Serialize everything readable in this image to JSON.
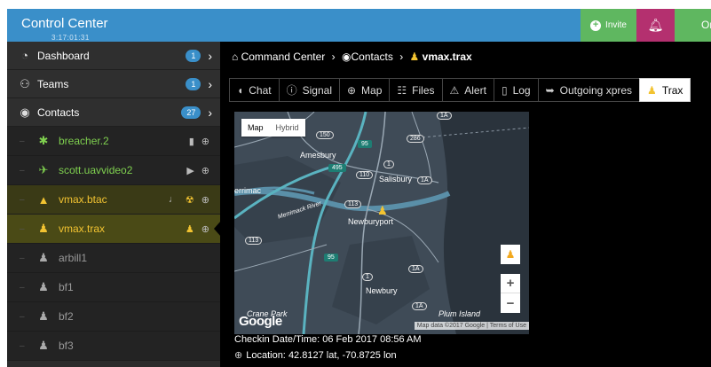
{
  "app": {
    "title": "Control Center",
    "clock": "3:17:01:31"
  },
  "topbar": {
    "invite_label": "Invite",
    "online_label": "Online",
    "accent": "#3a8fc9"
  },
  "sidebar": {
    "nav": [
      {
        "label": "Dashboard",
        "badge": "1",
        "icon": "dashboard-icon"
      },
      {
        "label": "Teams",
        "badge": "1",
        "icon": "teams-icon"
      },
      {
        "label": "Contacts",
        "badge": "27",
        "icon": "globe-icon"
      }
    ],
    "contacts": [
      {
        "name": "breacher.2",
        "icon": "robot-icon",
        "status": "green"
      },
      {
        "name": "scott.uavvideo2",
        "icon": "drone-icon",
        "status": "green"
      },
      {
        "name": "vmax.btac",
        "icon": "vehicle-icon",
        "status": "yellow"
      },
      {
        "name": "vmax.trax",
        "icon": "person-icon",
        "status": "yellow"
      },
      {
        "name": "arbill1",
        "icon": "person-icon",
        "status": "grey"
      },
      {
        "name": "bf1",
        "icon": "person-icon",
        "status": "grey"
      },
      {
        "name": "bf2",
        "icon": "person-icon",
        "status": "grey"
      },
      {
        "name": "bf3",
        "icon": "person-icon",
        "status": "grey"
      }
    ]
  },
  "breadcrumb": {
    "root": "Command Center",
    "section": "Contacts",
    "current": "vmax.trax"
  },
  "tabs": [
    "Chat",
    "Signal",
    "Map",
    "Files",
    "Alert",
    "Log",
    "Outgoing xpres",
    "Trax"
  ],
  "active_tab": "Trax",
  "map": {
    "mode_map": "Map",
    "mode_hybrid": "Hybrid",
    "labels": [
      "Amesbury",
      "Salisbury",
      "errimac",
      "Newburyport",
      "Newbury",
      "Crane Park",
      "Plum Island",
      "Merrimack River"
    ],
    "shields": [
      "150",
      "286",
      "95",
      "495",
      "1",
      "110",
      "1A",
      "113",
      "95",
      "1",
      "1A",
      "113",
      "1A",
      "1A"
    ],
    "attribution_data": "Map data ©2017 Google",
    "attribution_terms": "Terms of Use",
    "logo": "Google"
  },
  "checkin": {
    "label": "Checkin Date/Time:",
    "value": "06 Feb 2017 08:56 AM"
  },
  "location": {
    "label": "Location:",
    "value": "42.8127 lat, -70.8725 lon"
  }
}
